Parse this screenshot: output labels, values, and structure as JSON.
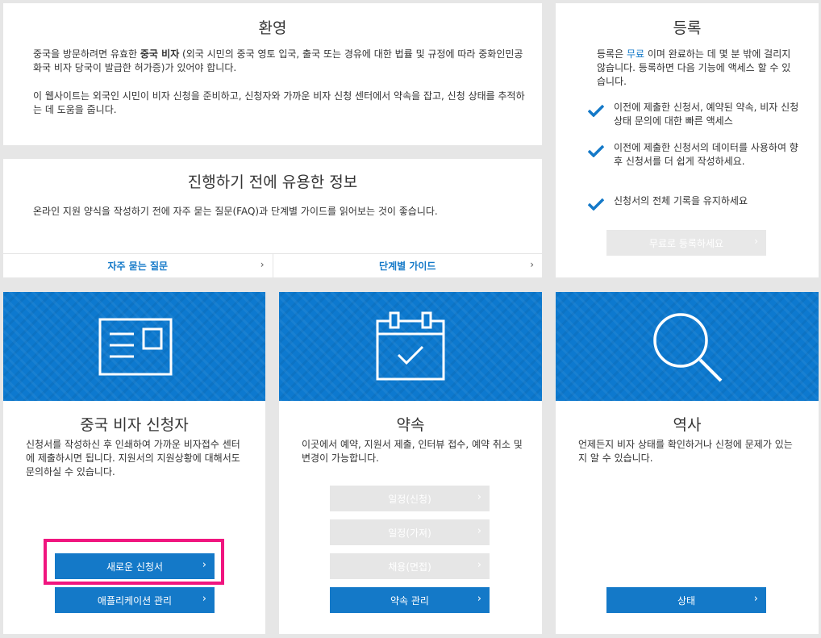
{
  "welcome": {
    "title": "환영",
    "para1_pre": "중국을 방문하려면 유효한 ",
    "para1_bold": "중국 비자",
    "para1_post": " (외국 시민의 중국 영토 입국, 출국 또는 경유에 대한 법률 및 규정에 따라 중화인민공화국 비자 당국이 발급한 허가증)가 있어야 합니다.",
    "para2": "이 웹사이트는 외국인 시민이 비자 신청을 준비하고, 신청자와 가까운 비자 신청 센터에서 약속을 잡고, 신청 상태를 추적하는 데 도움을 줍니다."
  },
  "info": {
    "title": "진행하기 전에 유용한 정보",
    "text": "온라인 지원 양식을 작성하기 전에 자주 묻는 질문(FAQ)과 단계별 가이드를 읽어보는 것이 좋습니다.",
    "links": [
      {
        "label": "자주 묻는 질문"
      },
      {
        "label": "단계별 가이드"
      }
    ]
  },
  "register": {
    "title": "등록",
    "intro_pre": "등록은 ",
    "intro_accent": "무료",
    "intro_post": " 이며 완료하는 데 몇 분 밖에 걸리지 않습니다. 등록하면 다음 기능에 액세스 할 수 있습니다.",
    "items": [
      {
        "text": "이전에 제출한 신청서, 예약된 약속, 비자 신청 상태 문의에 대한 빠른 액세스"
      },
      {
        "text": "이전에 제출한 신청서의 데이터를 사용하여 향후 신청서를 더 쉽게 작성하세요."
      },
      {
        "text": "신청서의 전체 기록을 유지하세요"
      }
    ],
    "button": "무료로 등록하세요"
  },
  "applicant": {
    "title": "중국 비자 신청자",
    "text": "신청서를 작성하신 후 인쇄하여 가까운 비자접수 센터에 제출하시면 됩니다. 지원서의 지원상황에 대해서도 문의하실 수 있습니다.",
    "btn_new": "새로운 신청서",
    "btn_manage": "애플리케이션 관리"
  },
  "appointment": {
    "title": "약속",
    "text": "이곳에서 예약, 지원서 제출, 인터뷰 접수, 예약 취소 및 변경이 가능합니다.",
    "btn1": "일정(신청)",
    "btn2": "일정(가져)",
    "btn3": "채용(면접)",
    "btn_manage": "약속 관리"
  },
  "history": {
    "title": "역사",
    "text": "언제든지 비자 상태를 확인하거나 신청에 문제가 있는지 알 수 있습니다.",
    "btn_status": "상태"
  },
  "colors": {
    "accent": "#1479c8",
    "banner": "#0d79cf",
    "highlight": "#f0157f"
  }
}
